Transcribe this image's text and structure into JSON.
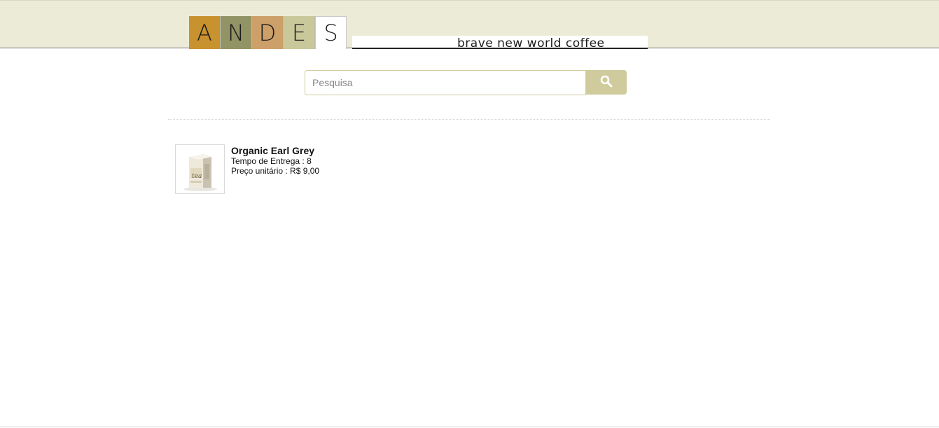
{
  "header": {
    "logo_letters": [
      "A",
      "N",
      "D",
      "E",
      "S"
    ],
    "logo_colors": [
      "#c8922f",
      "#939465",
      "#cda06a",
      "#c9c89a",
      "#ffffff"
    ],
    "tagline": "brave new world coffee",
    "background": "#ecebd8"
  },
  "search": {
    "placeholder": "Pesquisa",
    "value": "",
    "button_icon": "search-icon",
    "accent": "#cfcb9c"
  },
  "results": [
    {
      "name": "Organic Earl Grey",
      "delivery_label": "Tempo de Entrega : 8",
      "price_label": "Preço unitário : R$ 9,00",
      "thumbnail": "tea-box-image"
    }
  ]
}
